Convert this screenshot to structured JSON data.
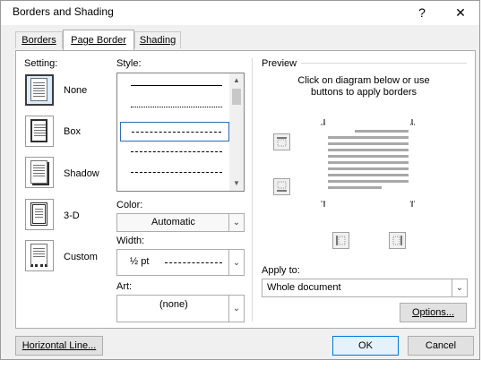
{
  "window": {
    "title": "Borders and Shading",
    "help_glyph": "?",
    "close_glyph": "✕"
  },
  "tabs": [
    {
      "label": "Borders"
    },
    {
      "label": "Page Border"
    },
    {
      "label": "Shading"
    }
  ],
  "setting": {
    "header": "Setting:",
    "options": [
      {
        "label": "None"
      },
      {
        "label": "Box"
      },
      {
        "label": "Shadow"
      },
      {
        "label": "3-D"
      },
      {
        "label": "Custom"
      }
    ]
  },
  "style": {
    "header": "Style:",
    "color_label": "Color:",
    "color_value": "Automatic",
    "width_label": "Width:",
    "width_value": "½ pt",
    "art_label": "Art:",
    "art_value": "(none)"
  },
  "preview": {
    "header": "Preview",
    "instruction": "Click on diagram below or use buttons to apply borders",
    "apply_label": "Apply to:",
    "apply_value": "Whole document",
    "options_button": "Options..."
  },
  "footer": {
    "horizontal_line": "Horizontal Line...",
    "ok": "OK",
    "cancel": "Cancel"
  },
  "colors": {
    "accent": "#0078d7",
    "selected_setting_bg": "#dcecfc"
  }
}
